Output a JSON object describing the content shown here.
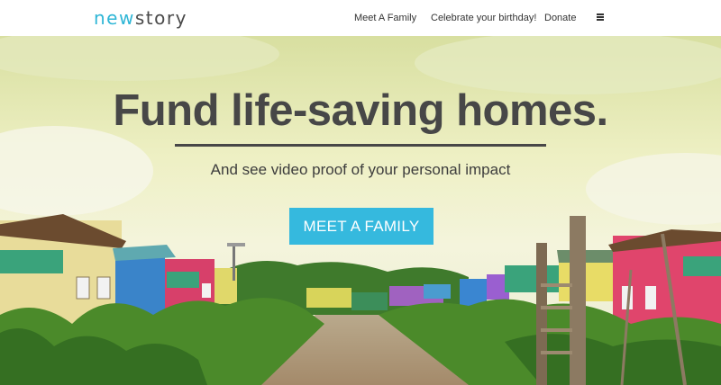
{
  "header": {
    "logo_part1": "new",
    "logo_part2": "story",
    "nav": [
      {
        "label": "Meet A Family"
      },
      {
        "label": "Celebrate your birthday!"
      },
      {
        "label": "Donate"
      }
    ],
    "menu_icon": "hamburger-menu-icon"
  },
  "hero": {
    "headline": "Fund life-saving homes.",
    "subline": "And see video proof of your personal impact",
    "cta_label": "MEET A FAMILY"
  },
  "colors": {
    "accent": "#35b9de",
    "logo_blue": "#2fb6d6",
    "text_dark": "#474747"
  }
}
